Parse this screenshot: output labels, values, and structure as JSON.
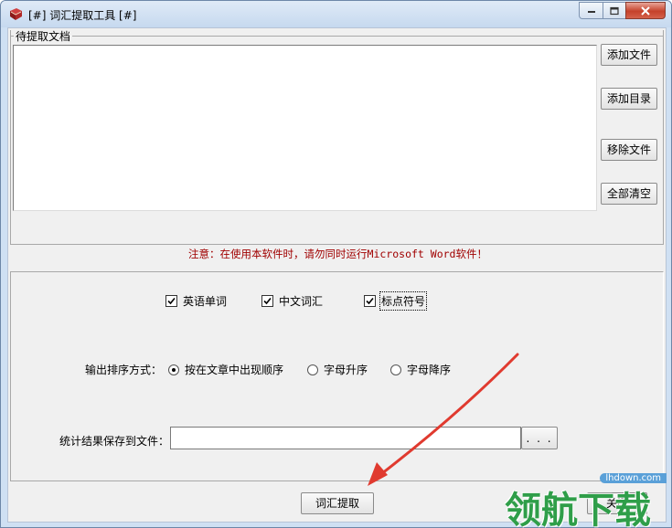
{
  "window": {
    "title": "[#] 词汇提取工具 [#]",
    "icon": "red-book-icon",
    "controls": [
      "minimize-icon",
      "maximize-icon",
      "close-icon"
    ]
  },
  "documents": {
    "group_label": "待提取文档",
    "buttons": {
      "add_file": "添加文件",
      "add_dir": "添加目录",
      "remove_file": "移除文件",
      "clear_all": "全部清空"
    }
  },
  "warning": "注意：在使用本软件时，请勿同时运行Microsoft Word软件！",
  "options": {
    "checkboxes": [
      {
        "label": "英语单词",
        "checked": true
      },
      {
        "label": "中文词汇",
        "checked": true
      },
      {
        "label": "标点符号",
        "checked": true
      }
    ],
    "sort_label": "输出排序方式：",
    "sort_options": [
      {
        "label": "按在文章中出现顺序",
        "selected": true
      },
      {
        "label": "字母升序",
        "selected": false
      },
      {
        "label": "字母降序",
        "selected": false
      }
    ],
    "save_label": "统计结果保存到文件：",
    "save_path_value": "",
    "browse_label": ". . ."
  },
  "footer": {
    "extract_button": "词汇提取",
    "close_button": "关闭"
  },
  "watermark": {
    "url": "lhdown.com",
    "text": "领航下载"
  },
  "colors": {
    "warning": "#a00000",
    "arrow": "#e03a2f",
    "watermark": "#2f9e49"
  }
}
